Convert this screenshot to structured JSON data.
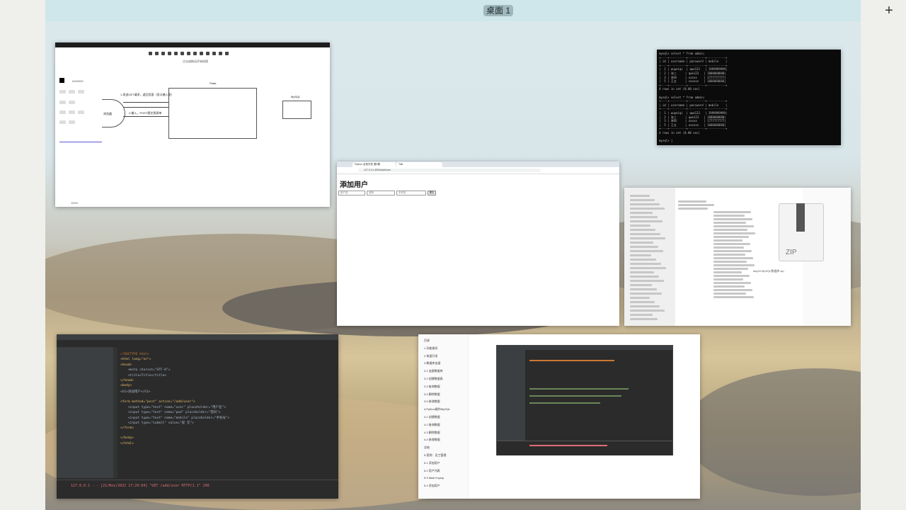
{
  "desktop": {
    "label": "桌面 1",
    "add_symbol": "+"
  },
  "excalidraw": {
    "title": "Excalidraw",
    "hint": "点击或拖动开始绘图",
    "stroke_color": "#000000",
    "nodes": {
      "client": "浏览器",
      "flask": "Flask",
      "mysql": "MySQL"
    },
    "arrows": {
      "get": "1.发送GET请求，返回页面（显示输入框）",
      "post": "2.输入，POST提交到表单"
    },
    "zoom": "100%"
  },
  "terminal": {
    "lines": [
      "mysql> select * from admin;",
      "+----+----------+----------+-----------+",
      "| id | username | password | mobile    |",
      "+----+----------+----------+-----------+",
      "|  1 | wupeiqi  | qwe123   | 1999999999|",
      "|  2 | 张三     | qwe123   | 1888888888|",
      "|  3 | 李四     | xxxxx    | 1777777777|",
      "|  5 | 王五     | xxxxxx   | 1666666666|",
      "+----+----------+----------+-----------+",
      "4 rows in set (0.00 sec)",
      "",
      "mysql> select * from admin;",
      "+----+----------+----------+-----------+",
      "| id | username | password | mobile    |",
      "+----+----------+----------+-----------+",
      "|  1 | wupeiqi  | qwe123   | 1999999999|",
      "|  2 | 张三     | qwe123   | 1888888888|",
      "|  3 | 李四     | xxxxx    | 1777777777|",
      "|  5 | 王五     | xxxxxx   | 1666666666|",
      "+----+----------+----------+-----------+",
      "4 rows in set (0.00 sec)",
      "",
      "mysql> |"
    ]
  },
  "browser": {
    "tab1": "Python 全栈开发-第5期",
    "tab2": "Title",
    "url": "127.0.0.1:5000/add/user",
    "page_title": "添加用户",
    "fields": [
      "用户名",
      "密码",
      "手机号"
    ],
    "submit": "提交"
  },
  "finder": {
    "preview_label": "ZIP",
    "file_name": "day16 MySQL数据库.zip"
  },
  "ide": {
    "code_lines": [
      "<!DOCTYPE html>",
      "<html lang=\"en\">",
      "<head>",
      "    <meta charset=\"UTF-8\">",
      "    <title>Title</title>",
      "</head>",
      "<body>",
      "<h1>添加用户</h1>",
      "",
      "<form method=\"post\" action=\"/add/user\">",
      "    <input type=\"text\" name=\"user\" placeholder=\"用户名\">",
      "    <input type=\"text\" name=\"pwd\" placeholder=\"密码\">",
      "    <input type=\"text\" name=\"mobile\" placeholder=\"手机号\">",
      "    <input type=\"submit\" value=\"提 交\">",
      "</form>",
      "",
      "</body>",
      "</html>"
    ],
    "log": "127.0.0.1 - - [21/Nov/2022 17:20:04] \"GET /add/user HTTP/1.1\" 200"
  },
  "doc": {
    "toc": [
      "目录",
      "1.功能推导",
      "2.快速开发",
      "3.数据库连接",
      "3.1 连接数据库",
      "3.2 创建数据表",
      "3.3 查询数据",
      "3.4 删除数据",
      "3.5 修改数据",
      "4.Python操作MySQL",
      "4.1 创建数据",
      "4.2 查询数据",
      "4.3 删除数据",
      "4.4 修改数据",
      "总结",
      "5.案例：员工管理",
      "5.1 添加用户",
      "5.2 用户列表",
      "5.3 flask+mysql",
      "5.4 添加用户"
    ]
  },
  "colors": {
    "desk_label_bg": "#9fb8bd",
    "log_red": "#e06c75"
  }
}
